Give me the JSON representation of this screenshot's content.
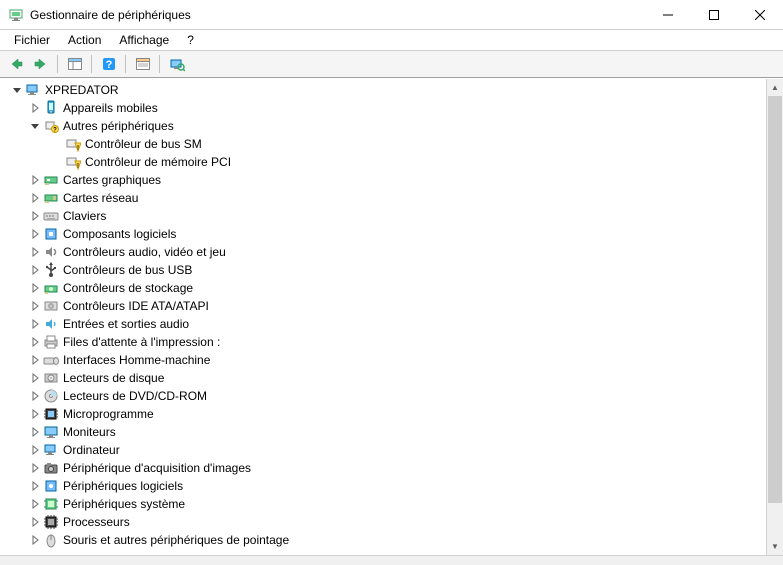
{
  "window": {
    "title": "Gestionnaire de périphériques"
  },
  "menu": {
    "file": "Fichier",
    "action": "Action",
    "view": "Affichage",
    "help": "?"
  },
  "tree": {
    "root": {
      "label": "XPREDATOR",
      "icon": "computer-icon",
      "expanded": true
    },
    "nodes": [
      {
        "label": "Appareils mobiles",
        "icon": "mobile-icon",
        "expander": "closed"
      },
      {
        "label": "Autres périphériques",
        "icon": "other-devices-icon",
        "expander": "open",
        "children": [
          {
            "label": "Contrôleur de bus SM",
            "icon": "unknown-device-icon"
          },
          {
            "label": "Contrôleur de mémoire PCI",
            "icon": "unknown-device-icon"
          }
        ]
      },
      {
        "label": "Cartes graphiques",
        "icon": "display-adapter-icon",
        "expander": "closed"
      },
      {
        "label": "Cartes réseau",
        "icon": "network-adapter-icon",
        "expander": "closed"
      },
      {
        "label": "Claviers",
        "icon": "keyboard-icon",
        "expander": "closed"
      },
      {
        "label": "Composants logiciels",
        "icon": "software-component-icon",
        "expander": "closed"
      },
      {
        "label": "Contrôleurs audio, vidéo et jeu",
        "icon": "audio-controller-icon",
        "expander": "closed"
      },
      {
        "label": "Contrôleurs de bus USB",
        "icon": "usb-controller-icon",
        "expander": "closed"
      },
      {
        "label": "Contrôleurs de stockage",
        "icon": "storage-controller-icon",
        "expander": "closed"
      },
      {
        "label": "Contrôleurs IDE ATA/ATAPI",
        "icon": "ide-controller-icon",
        "expander": "closed"
      },
      {
        "label": "Entrées et sorties audio",
        "icon": "audio-io-icon",
        "expander": "closed"
      },
      {
        "label": "Files d'attente à l'impression :",
        "icon": "print-queue-icon",
        "expander": "closed"
      },
      {
        "label": "Interfaces Homme-machine",
        "icon": "hid-icon",
        "expander": "closed"
      },
      {
        "label": "Lecteurs de disque",
        "icon": "disk-drive-icon",
        "expander": "closed"
      },
      {
        "label": "Lecteurs de DVD/CD-ROM",
        "icon": "optical-drive-icon",
        "expander": "closed"
      },
      {
        "label": "Microprogramme",
        "icon": "firmware-icon",
        "expander": "closed"
      },
      {
        "label": "Moniteurs",
        "icon": "monitor-icon",
        "expander": "closed"
      },
      {
        "label": "Ordinateur",
        "icon": "computer-category-icon",
        "expander": "closed"
      },
      {
        "label": "Périphérique d'acquisition d'images",
        "icon": "imaging-device-icon",
        "expander": "closed"
      },
      {
        "label": "Périphériques logiciels",
        "icon": "software-device-icon",
        "expander": "closed"
      },
      {
        "label": "Périphériques système",
        "icon": "system-device-icon",
        "expander": "closed"
      },
      {
        "label": "Processeurs",
        "icon": "processor-icon",
        "expander": "closed"
      },
      {
        "label": "Souris et autres périphériques de pointage",
        "icon": "mouse-icon",
        "expander": "closed"
      }
    ]
  }
}
